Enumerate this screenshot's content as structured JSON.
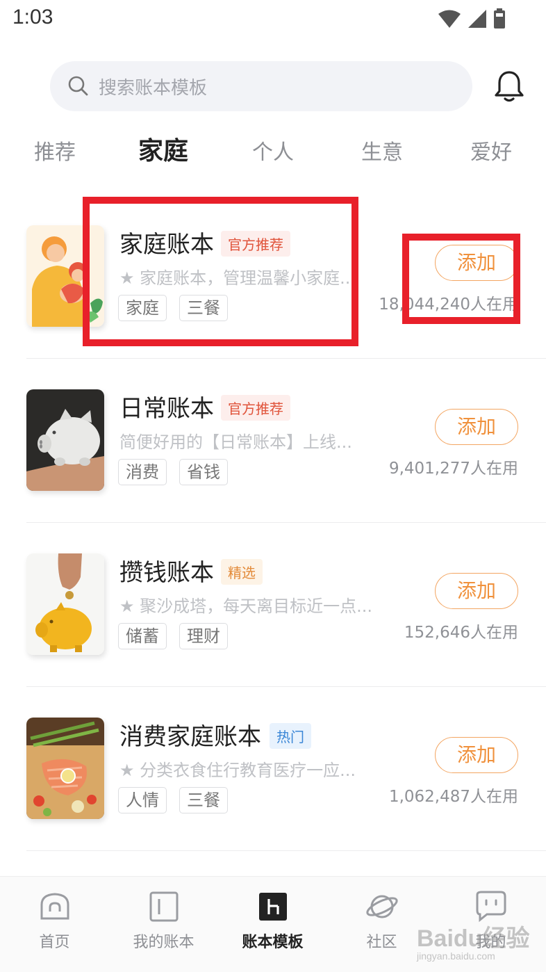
{
  "status": {
    "time": "1:03"
  },
  "search": {
    "placeholder": "搜索账本模板"
  },
  "tabs": [
    {
      "label": "推荐"
    },
    {
      "label": "家庭"
    },
    {
      "label": "个人"
    },
    {
      "label": "生意"
    },
    {
      "label": "爱好"
    }
  ],
  "items": [
    {
      "title": "家庭账本",
      "badge": "官方推荐",
      "description": "★ 家庭账本，管理温馨小家庭...",
      "tags": [
        "家庭",
        "三餐"
      ],
      "add_label": "添加",
      "users": "18,044,240人在用"
    },
    {
      "title": "日常账本",
      "badge": "官方推荐",
      "description": "简便好用的【日常账本】上线...",
      "tags": [
        "消费",
        "省钱"
      ],
      "add_label": "添加",
      "users": "9,401,277人在用"
    },
    {
      "title": "攒钱账本",
      "badge": "精选",
      "description": "★ 聚沙成塔，每天离目标近一点...",
      "tags": [
        "储蓄",
        "理财"
      ],
      "add_label": "添加",
      "users": "152,646人在用"
    },
    {
      "title": "消费家庭账本",
      "badge": "热门",
      "description": "★ 分类衣食住行教育医疗一应...",
      "tags": [
        "人情",
        "三餐"
      ],
      "add_label": "添加",
      "users": "1,062,487人在用"
    }
  ],
  "bottom_nav": [
    {
      "label": "首页",
      "icon": "home-icon"
    },
    {
      "label": "我的账本",
      "icon": "book-icon"
    },
    {
      "label": "账本模板",
      "icon": "template-icon"
    },
    {
      "label": "社区",
      "icon": "planet-icon"
    },
    {
      "label": "我的",
      "icon": "chat-face-icon"
    }
  ],
  "watermark": {
    "main": "Baidu经验",
    "sub": "jingyan.baidu.com"
  },
  "colors": {
    "accent": "#f0913c",
    "highlight": "#e8202a",
    "official_badge": "#e0533a",
    "hot_badge": "#3a86d6"
  }
}
